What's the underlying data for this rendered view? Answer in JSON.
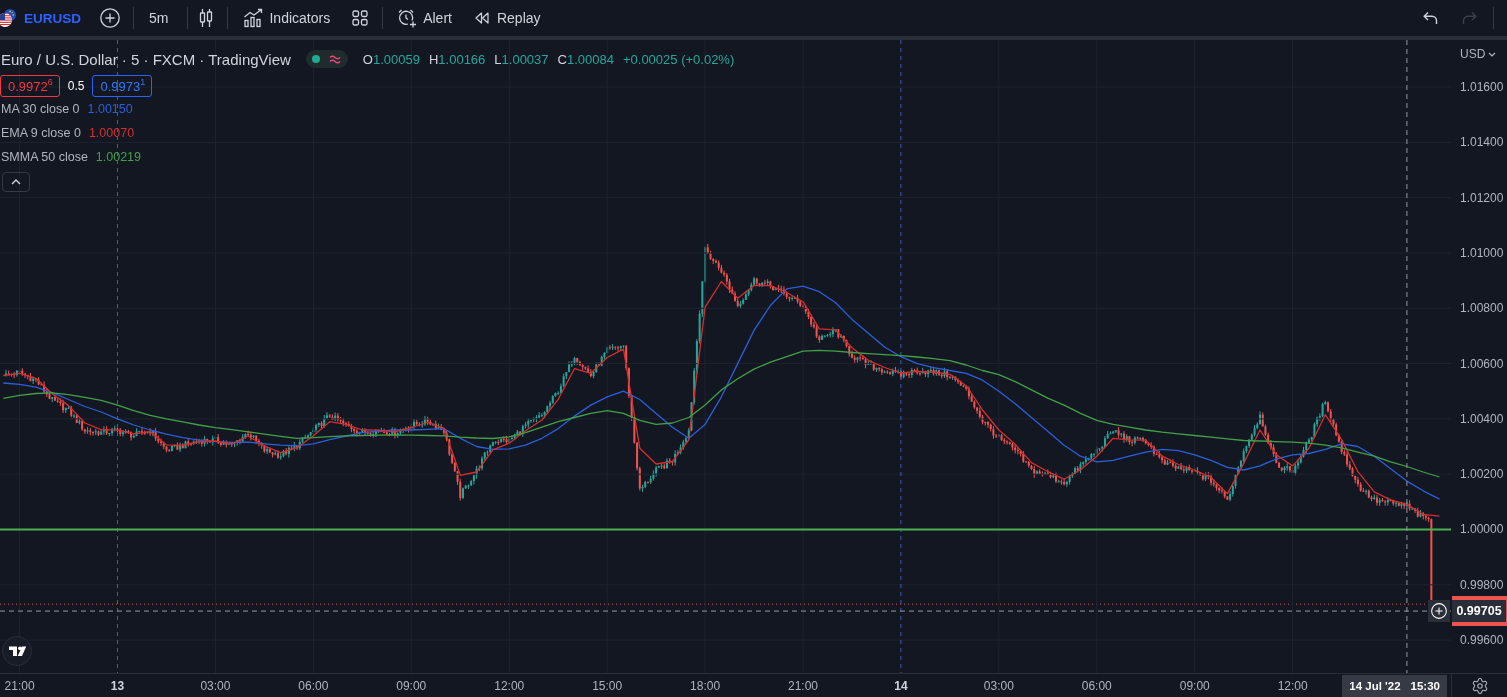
{
  "toolbar": {
    "items": [
      {
        "kind": "symbol",
        "label": "EURUSD"
      },
      {
        "kind": "add"
      },
      {
        "kind": "separator"
      },
      {
        "kind": "interval",
        "label": "5m"
      },
      {
        "kind": "separator"
      },
      {
        "kind": "chart-type"
      },
      {
        "kind": "separator"
      },
      {
        "kind": "indicators",
        "label": "Indicators"
      },
      {
        "kind": "templates"
      },
      {
        "kind": "separator"
      },
      {
        "kind": "alert",
        "label": "Alert"
      },
      {
        "kind": "replay",
        "label": "Replay"
      }
    ],
    "history": [
      {
        "kind": "undo",
        "disabled": false
      },
      {
        "kind": "redo",
        "disabled": true
      }
    ]
  },
  "legend": {
    "rising": true,
    "ohlc": [
      {
        "label": "O",
        "value": "1.00059"
      },
      {
        "label": "H",
        "value": "1.00166"
      },
      {
        "label": "L",
        "value": "1.00037"
      },
      {
        "label": "C",
        "value": "1.00084"
      }
    ],
    "change": "+0.00025 (+0.02%)",
    "bid": "0.9972$^{6}$",
    "spread": "0.5",
    "ask": "0.9973$^{1}$",
    "indicators_expanded": true,
    "indicators": [
      {
        "name": "MA 30 close 0",
        "value": "1.00150"
      },
      {
        "name": "EMA 9 close 0",
        "value": "1.00070"
      },
      {
        "name": "SMMA 50 close",
        "value": "1.00219"
      }
    ]
  },
  "price_scale": {
    "currency": "USD"
  },
  "crosshair": {
    "date": "14 Jul '22"
  },
  "chart_data": {
    "type": "line",
    "title": "Euro / U.S. Dollar · 5 · FXCM · TradingView",
    "grid": true,
    "x": [
      "2022-07-12 20:30",
      "2022-07-12 21:00",
      "2022-07-12 21:30",
      "2022-07-12 22:00",
      "2022-07-12 22:30",
      "2022-07-12 23:00",
      "2022-07-12 23:30",
      "2022-07-13 00:00",
      "2022-07-13 00:30",
      "2022-07-13 01:00",
      "2022-07-13 01:30",
      "2022-07-13 02:00",
      "2022-07-13 02:30",
      "2022-07-13 03:00",
      "2022-07-13 03:30",
      "2022-07-13 04:00",
      "2022-07-13 04:30",
      "2022-07-13 05:00",
      "2022-07-13 05:30",
      "2022-07-13 06:00",
      "2022-07-13 06:30",
      "2022-07-13 07:00",
      "2022-07-13 07:30",
      "2022-07-13 08:00",
      "2022-07-13 08:30",
      "2022-07-13 09:00",
      "2022-07-13 09:30",
      "2022-07-13 10:00",
      "2022-07-13 10:30",
      "2022-07-13 11:00",
      "2022-07-13 11:30",
      "2022-07-13 12:00",
      "2022-07-13 12:30",
      "2022-07-13 13:00",
      "2022-07-13 13:30",
      "2022-07-13 14:00",
      "2022-07-13 14:30",
      "2022-07-13 15:00",
      "2022-07-13 15:30",
      "2022-07-13 16:00",
      "2022-07-13 16:30",
      "2022-07-13 17:00",
      "2022-07-13 17:30",
      "2022-07-13 18:00",
      "2022-07-13 18:30",
      "2022-07-13 19:00",
      "2022-07-13 19:30",
      "2022-07-13 20:00",
      "2022-07-13 20:30",
      "2022-07-13 21:00",
      "2022-07-13 21:30",
      "2022-07-13 22:00",
      "2022-07-13 22:30",
      "2022-07-13 23:00",
      "2022-07-13 23:30",
      "2022-07-14 00:00",
      "2022-07-14 00:30",
      "2022-07-14 01:00",
      "2022-07-14 01:30",
      "2022-07-14 02:00",
      "2022-07-14 02:30",
      "2022-07-14 03:00",
      "2022-07-14 03:30",
      "2022-07-14 04:00",
      "2022-07-14 04:30",
      "2022-07-14 05:00",
      "2022-07-14 05:30",
      "2022-07-14 06:00",
      "2022-07-14 06:30",
      "2022-07-14 07:00",
      "2022-07-14 07:30",
      "2022-07-14 08:00",
      "2022-07-14 08:30",
      "2022-07-14 09:00",
      "2022-07-14 09:30",
      "2022-07-14 10:00",
      "2022-07-14 10:30",
      "2022-07-14 11:00",
      "2022-07-14 11:30",
      "2022-07-14 12:00",
      "2022-07-14 12:30",
      "2022-07-14 13:00",
      "2022-07-14 13:30",
      "2022-07-14 14:00",
      "2022-07-14 14:30",
      "2022-07-14 15:00",
      "2022-07-14 15:30",
      "2022-07-14 16:00",
      "2022-07-14 16:30"
    ],
    "xlim": [
      "2022-07-12 20:24",
      "2022-07-14 18:34"
    ],
    "ylim": [
      0.99481,
      1.01915
    ],
    "xticks": [
      {
        "value": "2022-07-12 21:00",
        "label": "21:00"
      },
      {
        "value": "2022-07-13 00:00",
        "label": "13"
      },
      {
        "value": "2022-07-13 03:00",
        "label": "03:00"
      },
      {
        "value": "2022-07-13 06:00",
        "label": "06:00"
      },
      {
        "value": "2022-07-13 09:00",
        "label": "09:00"
      },
      {
        "value": "2022-07-13 12:00",
        "label": "12:00"
      },
      {
        "value": "2022-07-13 15:00",
        "label": "15:00"
      },
      {
        "value": "2022-07-13 18:00",
        "label": "18:00"
      },
      {
        "value": "2022-07-13 21:00",
        "label": "21:00"
      },
      {
        "value": "2022-07-14 00:00",
        "label": "14"
      },
      {
        "value": "2022-07-14 03:00",
        "label": "03:00"
      },
      {
        "value": "2022-07-14 06:00",
        "label": "06:00"
      },
      {
        "value": "2022-07-14 09:00",
        "label": "09:00"
      },
      {
        "value": "2022-07-14 12:00",
        "label": "12:00"
      }
    ],
    "yticks": [
      {
        "value": 0.996,
        "label": "0.99600"
      },
      {
        "value": 0.998,
        "label": "0.99800"
      },
      {
        "value": 1.0,
        "label": "1.00000"
      },
      {
        "value": 1.002,
        "label": "1.00200"
      },
      {
        "value": 1.004,
        "label": "1.00400"
      },
      {
        "value": 1.006,
        "label": "1.00600"
      },
      {
        "value": 1.008,
        "label": "1.00800"
      },
      {
        "value": 1.01,
        "label": "1.01000"
      },
      {
        "value": 1.012,
        "label": "1.01200"
      },
      {
        "value": 1.014,
        "label": "1.01400"
      },
      {
        "value": 1.016,
        "label": "1.01600"
      }
    ],
    "series": [
      {
        "color": "#2b5fd9",
        "values": [
          1.0053,
          1.00525,
          1.00515,
          1.00495,
          1.0047,
          1.00445,
          1.00425,
          1.004,
          1.00378,
          1.0036,
          1.00345,
          1.00332,
          1.00323,
          1.00318,
          1.00315,
          1.00316,
          1.0031,
          1.00305,
          1.00303,
          1.0031,
          1.00325,
          1.00338,
          1.0035,
          1.00356,
          1.0036,
          1.0036,
          1.00362,
          1.00365,
          1.0033,
          1.003,
          1.0029,
          1.00292,
          1.00305,
          1.0033,
          1.00365,
          1.0041,
          1.0045,
          1.0048,
          1.005,
          1.0047,
          1.0042,
          1.0037,
          1.0033,
          1.0038,
          1.0048,
          1.006,
          1.0072,
          1.0081,
          1.0087,
          1.0088,
          1.0086,
          1.0082,
          1.0076,
          1.0071,
          1.0066,
          1.00625,
          1.006,
          1.00585,
          1.00575,
          1.00565,
          1.0054,
          1.005,
          1.00455,
          1.00405,
          1.00355,
          1.00305,
          1.00265,
          1.00245,
          1.0025,
          1.00265,
          1.0028,
          1.0029,
          1.00285,
          1.0027,
          1.0025,
          1.00225,
          1.00215,
          1.0023,
          1.00255,
          1.0027,
          1.00275,
          1.0029,
          1.0031,
          1.003,
          1.00265,
          1.0022,
          1.00175,
          1.0014,
          1.0011
        ]
      },
      {
        "color": "#d32f2f",
        "values": [
          1.00557,
          1.00565,
          1.00547,
          1.00491,
          1.00448,
          1.00385,
          1.00361,
          1.00359,
          1.00346,
          1.00354,
          1.00306,
          1.00305,
          1.00317,
          1.0032,
          1.00309,
          1.00338,
          1.00302,
          1.00278,
          1.00296,
          1.00339,
          1.0039,
          1.0038,
          1.0036,
          1.00359,
          1.00353,
          1.00369,
          1.00387,
          1.00367,
          1.00196,
          1.00208,
          1.00288,
          1.00312,
          1.00357,
          1.00396,
          1.00471,
          1.00582,
          1.00565,
          1.00622,
          1.00652,
          1.00294,
          1.00237,
          1.00246,
          1.00324,
          1.00804,
          1.00897,
          1.00836,
          1.00882,
          1.00882,
          1.00857,
          1.00824,
          1.00726,
          1.00722,
          1.00657,
          1.00612,
          1.00586,
          1.00566,
          1.00572,
          1.00569,
          1.00561,
          1.0052,
          1.00432,
          1.0036,
          1.00308,
          1.00242,
          1.00209,
          1.00182,
          1.00216,
          1.00265,
          1.0033,
          1.00324,
          1.00323,
          1.00266,
          1.00235,
          1.00215,
          1.00188,
          1.0013,
          1.00239,
          1.0036,
          1.0027,
          1.0023,
          1.00294,
          1.00415,
          1.00325,
          1.00209,
          1.00136,
          1.00107,
          1.00091,
          1.00055,
          1.00048
        ]
      },
      {
        "color": "#43a047",
        "values": [
          1.00474,
          1.00485,
          1.00492,
          1.00494,
          1.00488,
          1.00478,
          1.00467,
          1.0045,
          1.0043,
          1.00413,
          1.004,
          1.00389,
          1.00378,
          1.00368,
          1.00361,
          1.00353,
          1.00345,
          1.00337,
          1.0033,
          1.00332,
          1.00336,
          1.00339,
          1.0034,
          1.00341,
          1.00342,
          1.00341,
          1.0034,
          1.00339,
          1.00334,
          1.00331,
          1.00329,
          1.00335,
          1.0035,
          1.0037,
          1.0039,
          1.00405,
          1.0042,
          1.0043,
          1.0042,
          1.00395,
          1.0038,
          1.00385,
          1.00405,
          1.0045,
          1.00505,
          1.00545,
          1.0058,
          1.00605,
          1.00625,
          1.00645,
          1.00648,
          1.00645,
          1.0064,
          1.00636,
          1.00632,
          1.00629,
          1.00624,
          1.00618,
          1.00611,
          1.00595,
          1.00575,
          1.0056,
          1.00535,
          1.00505,
          1.00475,
          1.0045,
          1.0042,
          1.00395,
          1.0038,
          1.0037,
          1.0036,
          1.00352,
          1.00346,
          1.0034,
          1.00334,
          1.00328,
          1.00322,
          1.0032,
          1.00318,
          1.00316,
          1.00312,
          1.00305,
          1.00295,
          1.0028,
          1.00265,
          1.00245,
          1.00228,
          1.00208,
          1.0019
        ]
      }
    ],
    "ref_lines": [
      {
        "axis": "y",
        "value": 1.0,
        "color": "#4caf50"
      },
      {
        "axis": "y",
        "value": 0.99705,
        "color": "#9598a1",
        "label": "0.99705"
      },
      {
        "axis": "x",
        "value": "2022-07-14 15:30",
        "color": "#9598a1",
        "label": "15:30"
      }
    ]
  }
}
